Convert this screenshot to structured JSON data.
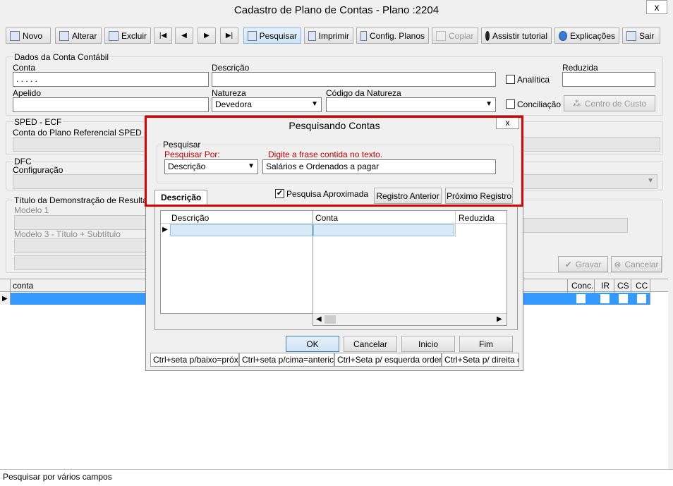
{
  "window": {
    "title": "Cadastro de Plano de Contas - Plano :2204",
    "close": "x"
  },
  "toolbar": {
    "novo": "Novo",
    "alterar": "Alterar",
    "excluir": "Excluir",
    "pesquisar": "Pesquisar",
    "imprimir": "Imprimir",
    "config_planos": "Config. Planos",
    "copiar": "Copiar",
    "assistir_tutorial": "Assistir tutorial",
    "explicacoes": "Explicações",
    "sair": "Sair"
  },
  "form": {
    "dados_title": "Dados da Conta Contábil",
    "conta_label": "Conta",
    "conta_value": ". . . . .",
    "descricao_label": "Descrição",
    "descricao_value": "",
    "analitica_label": "Analítica",
    "reduzida_label": "Reduzida",
    "apelido_label": "Apelido",
    "natureza_label": "Natureza",
    "natureza_value": "Devedora",
    "codigo_natureza_label": "Código da Natureza",
    "conciliacao_label": "Conciliação",
    "centro_custo": "Centro de Custo",
    "sped_title": "SPED - ECF",
    "sped_conta_label": "Conta do Plano Referencial SPED - ECI",
    "dfc_title": "DFC",
    "dfc_config_label": "Configuração",
    "titulo_dem_title": "Título da Demonstração de Resultado",
    "modelo1_label": "Modelo 1",
    "modelo3_label": "Modelo 3 - Título + Subtítulo",
    "gravar": "Gravar",
    "cancelar": "Cancelar"
  },
  "grid": {
    "col_conta": "conta",
    "col_conc": "Conc.",
    "col_ir": "IR",
    "col_cs": "CS",
    "col_cc": "CC"
  },
  "status": {
    "text": "Pesquisar por vários campos"
  },
  "dialog": {
    "title": "Pesquisando Contas",
    "close": "x",
    "pesquisar_group": "Pesquisar",
    "pesquisar_por_label": "Pesquisar Por:",
    "pesquisar_por_value": "Descrição",
    "frase_label": "Digite a frase contida no texto.",
    "frase_value": "Salários e Ordenados a pagar",
    "tab_descricao": "Descrição",
    "pesquisa_aproximada": "Pesquisa Aproximada",
    "registro_anterior": "Registro Anterior",
    "proximo_registro": "Próximo Registro",
    "columns": [
      "Descrição",
      "Conta",
      "Reduzida"
    ],
    "ok": "OK",
    "cancelar": "Cancelar",
    "inicio": "Inicio",
    "fim": "Fim",
    "status": [
      "Ctrl+seta p/baixo=próxi",
      "Ctrl+seta p/cima=anteric",
      "Ctrl+Seta p/ esquerda order",
      "Ctrl+Seta p/ direita o"
    ]
  },
  "colors": {
    "selected_row": "#3399ff",
    "highlight_border": "#e00000",
    "grid_sel_cell": "#d9ebf9"
  }
}
